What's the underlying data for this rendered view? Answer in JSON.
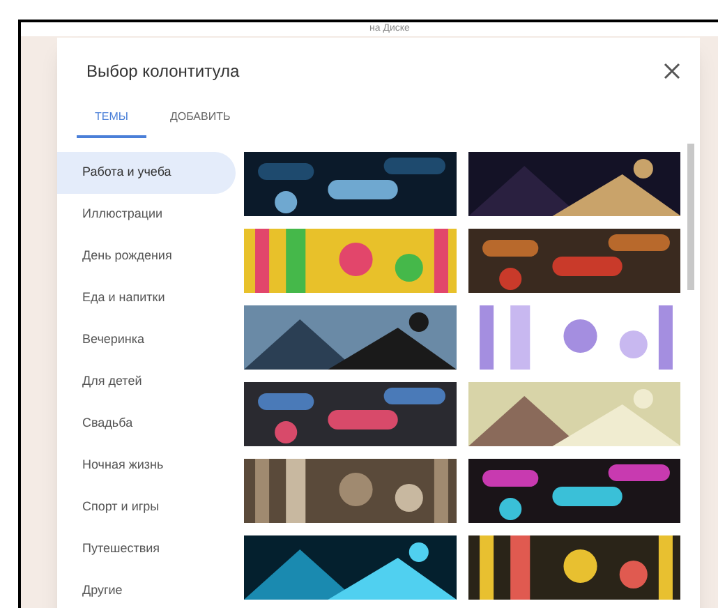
{
  "background": {
    "caption": "на Диске"
  },
  "dialog": {
    "title": "Выбор колонтитула",
    "tabs": [
      {
        "label": "ТЕМЫ",
        "selected": true
      },
      {
        "label": "ДОБАВИТЬ",
        "selected": false
      }
    ],
    "categories": [
      {
        "label": "Работа и учеба",
        "selected": true
      },
      {
        "label": "Иллюстрации",
        "selected": false
      },
      {
        "label": "День рождения",
        "selected": false
      },
      {
        "label": "Еда и напитки",
        "selected": false
      },
      {
        "label": "Вечеринка",
        "selected": false
      },
      {
        "label": "Для детей",
        "selected": false
      },
      {
        "label": "Свадьба",
        "selected": false
      },
      {
        "label": "Ночная жизнь",
        "selected": false
      },
      {
        "label": "Спорт и игры",
        "selected": false
      },
      {
        "label": "Путешествия",
        "selected": false
      },
      {
        "label": "Другие",
        "selected": false
      }
    ]
  }
}
